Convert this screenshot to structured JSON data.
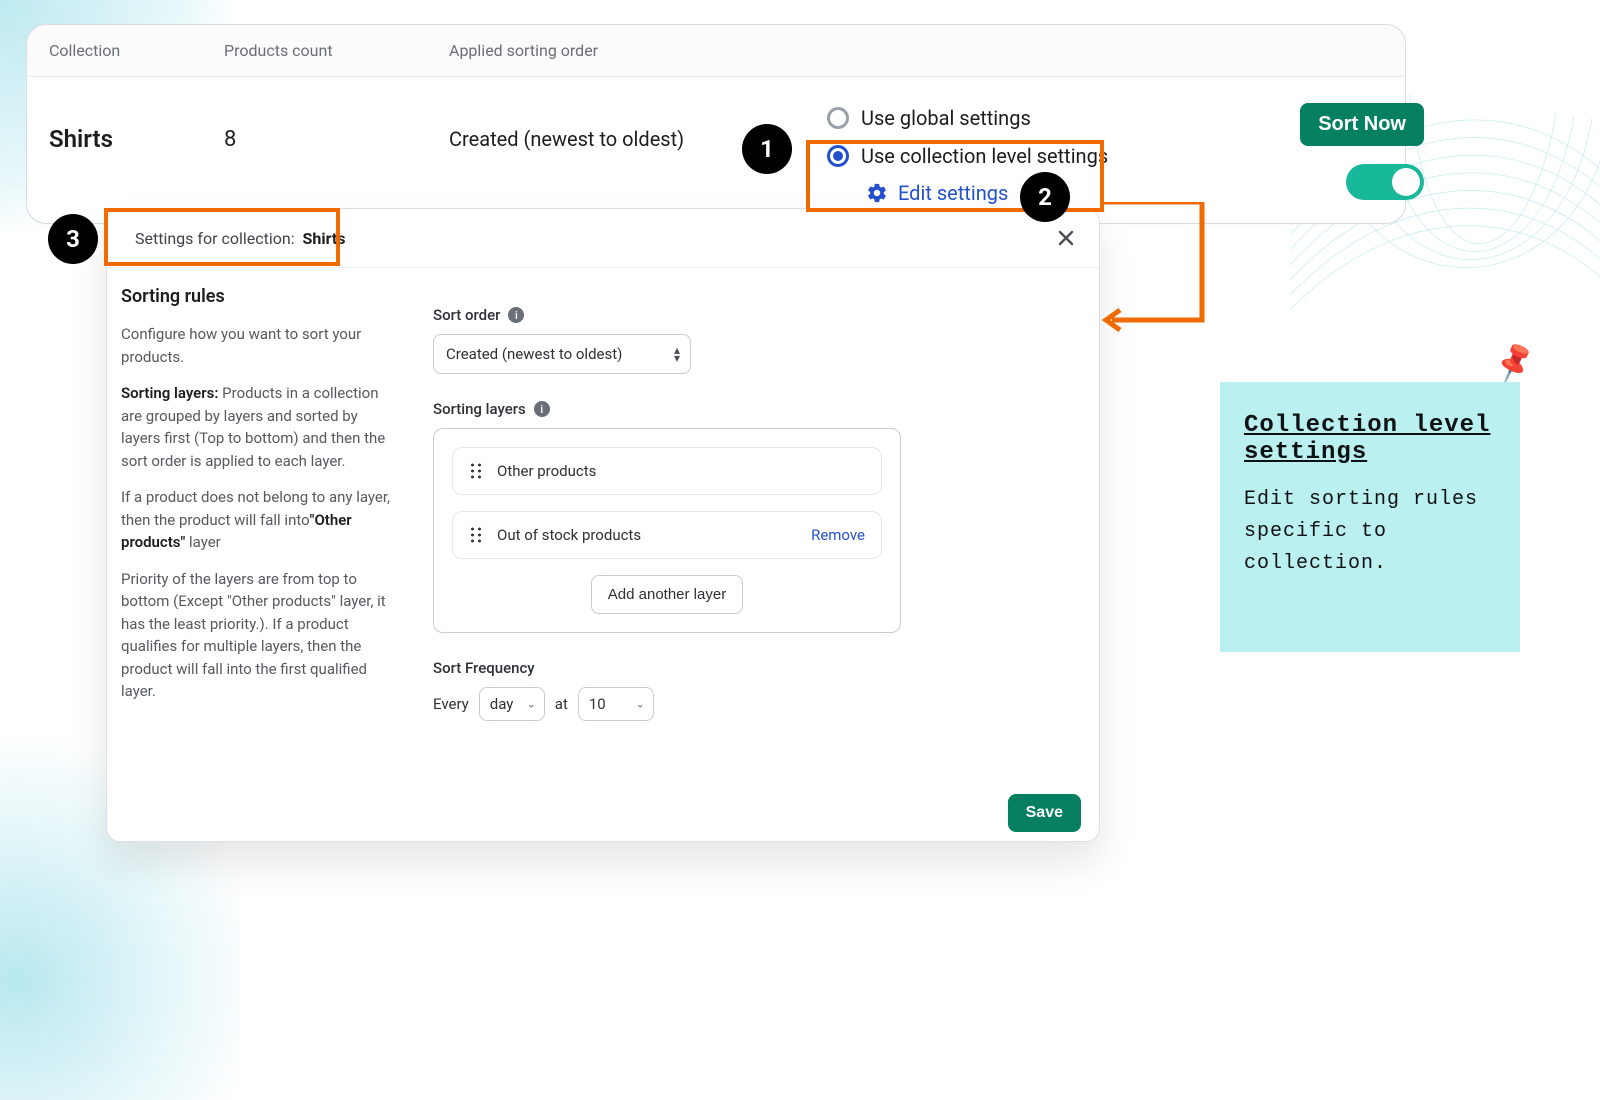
{
  "table": {
    "headers": {
      "collection": "Collection",
      "count": "Products count",
      "sort": "Applied sorting order"
    },
    "row": {
      "name": "Shirts",
      "count": "8",
      "sort": "Created (newest to oldest)",
      "radio_global": "Use global settings",
      "radio_collection": "Use collection level settings",
      "edit_settings": "Edit settings",
      "sort_now": "Sort Now"
    }
  },
  "dialog": {
    "title_prefix": "Settings for collection:",
    "title_name": "Shirts",
    "left": {
      "heading": "Sorting rules",
      "p1": "Configure how you want to sort your products.",
      "p2a": "Sorting layers:",
      "p2b": " Products in a collection are grouped by layers and sorted by layers first (Top to bottom) and then the sort order is applied to each layer.",
      "p3a": "If a product does not belong to any layer, then the product will fall into",
      "p3b": "\"Other products\"",
      "p3c": " layer",
      "p4": "Priority of the layers are from top to bottom (Except \"Other products\" layer, it has the least priority.). If a product qualifies for multiple layers, then the product will fall into the first qualified layer."
    },
    "right": {
      "sort_order_label": "Sort order",
      "sort_order_value": "Created (newest to oldest)",
      "sorting_layers_label": "Sorting layers",
      "layers": [
        {
          "name": "Other products",
          "removable": false
        },
        {
          "name": "Out of stock products",
          "removable": true,
          "remove_label": "Remove"
        }
      ],
      "add_layer": "Add another layer",
      "freq_label": "Sort Frequency",
      "freq_every": "Every",
      "freq_unit": "day",
      "freq_at": "at",
      "freq_time": "10"
    },
    "save": "Save"
  },
  "steps": {
    "s1": "1",
    "s2": "2",
    "s3": "3"
  },
  "note": {
    "title": "Collection level settings",
    "body": "Edit sorting rules specific to collection."
  },
  "icons": {
    "pin": "📌"
  }
}
